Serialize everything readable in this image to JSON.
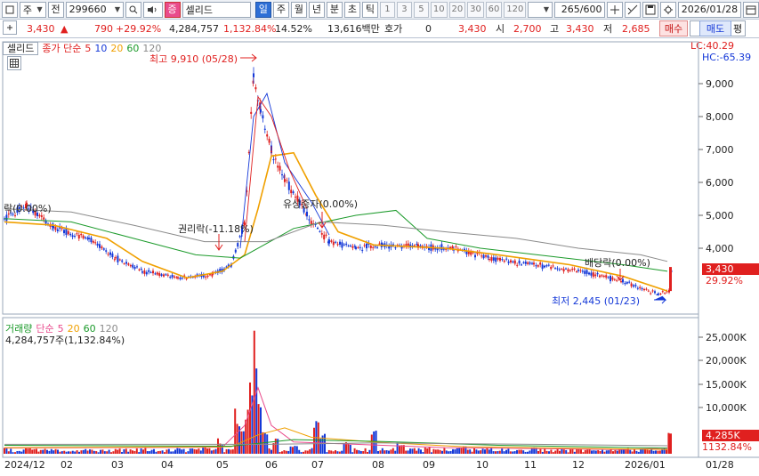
{
  "toolbar": {
    "market_label": "주",
    "prev_label": "전",
    "stock_code": "299660",
    "stock_name": "셀리드",
    "badge": "증",
    "periods": [
      "일",
      "주",
      "월",
      "년",
      "분",
      "초",
      "틱"
    ],
    "selected_period": "일",
    "intervals": [
      "1",
      "3",
      "5",
      "10",
      "20",
      "30",
      "60",
      "120"
    ],
    "count": "265/600",
    "date": "2026/01/28"
  },
  "quote": {
    "price": "3,430",
    "change": "790",
    "change_pct": "+29.92%",
    "volume": "4,284,757",
    "volume_pct": "1,132.84%",
    "turnover_pct": "14.52%",
    "amount": "13,616백만",
    "hoga_label": "호가",
    "hoga_value": "0",
    "current": "3,430",
    "open_label": "시",
    "open": "2,700",
    "high_label": "고",
    "high": "3,430",
    "low_label": "저",
    "low": "2,685",
    "buy_label": "매수",
    "sell_label": "매도",
    "eval_label": "평"
  },
  "price_panel": {
    "name": "셀리드",
    "ma_label": "종가 단순",
    "ma_periods": [
      "5",
      "10",
      "20",
      "60",
      "120"
    ],
    "ma_colors": [
      "#e0201f",
      "#1438d8",
      "#f0a000",
      "#1b9a2a",
      "#8a8a8a"
    ],
    "lc": "LC:40.29",
    "hc": "HC:-65.39",
    "high_note": "최고 9,910 (05/28)",
    "low_note": "최저 2,445 (01/23)",
    "event_rights": "권리락(-11.18%)",
    "event_capital": "유상증자(0.00%)",
    "event_dividend": "배당락(0.00%)",
    "event_left": "락(0.00%)",
    "last_price": "3,430",
    "last_pct": "29.92%",
    "y_ticks": [
      "9,000",
      "8,000",
      "7,000",
      "6,000",
      "5,000",
      "4,000"
    ]
  },
  "volume_panel": {
    "title": "거래량",
    "ma_label": "단순",
    "ma_periods": [
      "5",
      "20",
      "60",
      "120"
    ],
    "value_note": "4,284,757주(1,132.84%)",
    "y_ticks": [
      "25,000K",
      "20,000K",
      "15,000K",
      "10,000K"
    ],
    "last_volume": "4,285K",
    "last_pct": "1132.84%"
  },
  "x_axis": {
    "labels": [
      "2024/12",
      "02",
      "03",
      "04",
      "05",
      "06",
      "07",
      "08",
      "09",
      "10",
      "11",
      "12",
      "2026/01"
    ],
    "right_label": "01/28"
  }
}
